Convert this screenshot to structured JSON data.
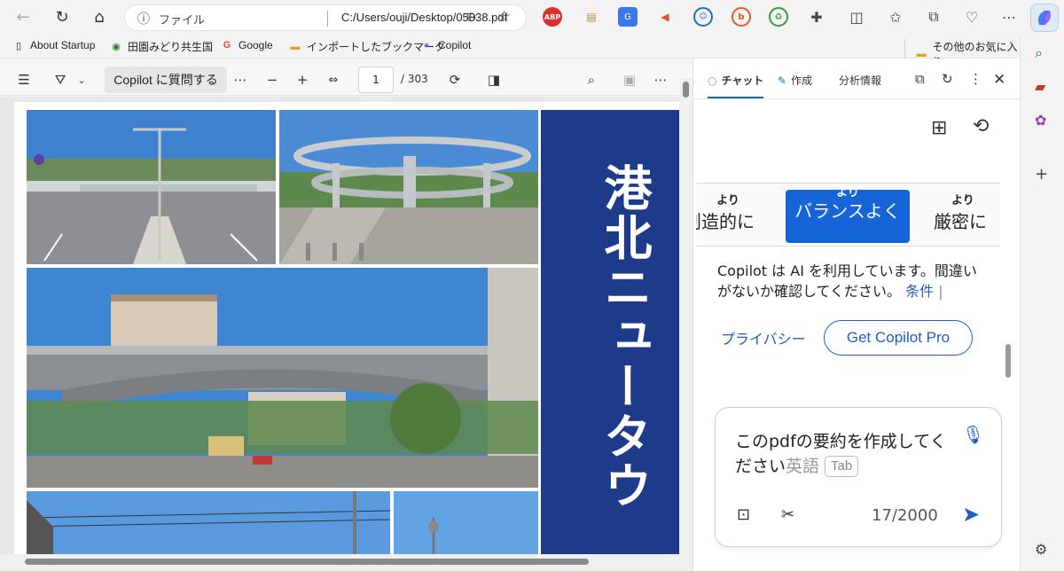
{
  "browser": {
    "address": {
      "label": "ファイル",
      "url": "C:/Users/ouji/Desktop/05038.pdf"
    },
    "extensions": [
      "abp-icon",
      "clipboard-icon",
      "translate-icon",
      "megaphone-icon",
      "chat-bubble-icon",
      "b-icon",
      "recycle-icon",
      "puzzle-icon",
      "split-screen-icon",
      "favorites-icon",
      "collections-icon",
      "heart-pulse-icon",
      "more-icon"
    ]
  },
  "bookmarks": {
    "items": [
      "About Startup",
      "田園みどり共生国",
      "Google",
      "インポートしたブックマーク",
      "Copilot"
    ],
    "other": "その他のお気に入り"
  },
  "pdf_toolbar": {
    "ask_label": "Copilot に質問する",
    "page_current": "1",
    "page_total": "/ 303"
  },
  "pdf_page": {
    "title_text": "港北ニュータウ"
  },
  "copilot": {
    "tabs": [
      "チャット",
      "作成",
      "分析情報"
    ],
    "tones": [
      {
        "small": "より",
        "large": "創造的に"
      },
      {
        "small": "より",
        "large": "バランスよく"
      },
      {
        "small": "より",
        "large": "厳密に"
      }
    ],
    "disclaimer": "Copilot は AI を利用しています。間違いがないか確認してください。",
    "terms_link": "条件",
    "privacy_link": "プライバシー",
    "get_pro": "Get Copilot Pro",
    "composer": {
      "text": "このpdfの要約を作成してください",
      "suggestion": "英語",
      "tab_hint": "Tab",
      "count": "17/2000"
    }
  },
  "colors": {
    "accent": "#1f5fbf",
    "tone_selected": "#1565d8",
    "navy_band": "#1e3a8a"
  }
}
